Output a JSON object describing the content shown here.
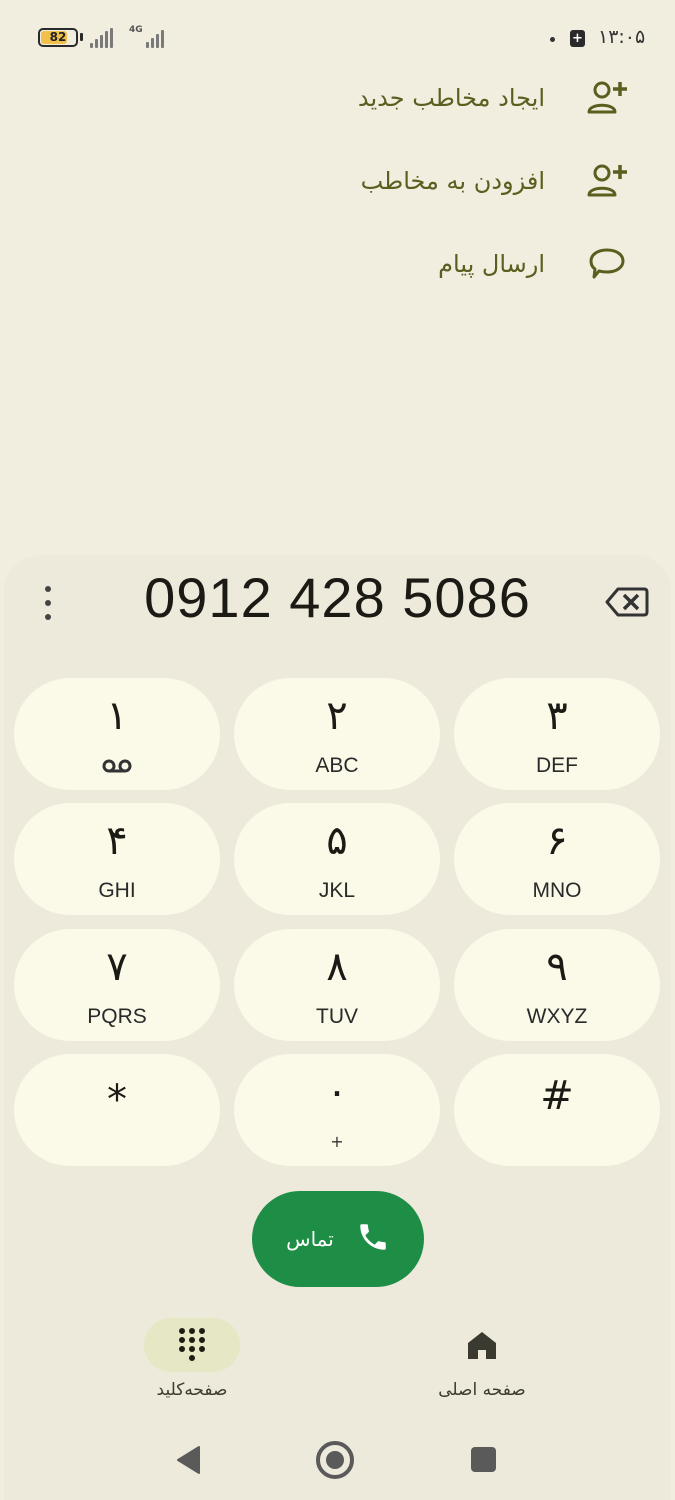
{
  "status_bar": {
    "battery_level": "82",
    "network_type": "4G",
    "time": "۱۳:۰۵",
    "notification_glyph": "+"
  },
  "actions": [
    {
      "label": "ایجاد مخاطب جدید",
      "icon": "person-add-icon"
    },
    {
      "label": "افزودن به مخاطب",
      "icon": "person-add-icon"
    },
    {
      "label": "ارسال پیام",
      "icon": "message-bubble-icon"
    }
  ],
  "dialer": {
    "number": "0912 428 5086",
    "keys": [
      {
        "digit": "۱",
        "sub": "voicemail-icon"
      },
      {
        "digit": "۲",
        "sub": "ABC"
      },
      {
        "digit": "۳",
        "sub": "DEF"
      },
      {
        "digit": "۴",
        "sub": "GHI"
      },
      {
        "digit": "۵",
        "sub": "JKL"
      },
      {
        "digit": "۶",
        "sub": "MNO"
      },
      {
        "digit": "۷",
        "sub": "PQRS"
      },
      {
        "digit": "۸",
        "sub": "TUV"
      },
      {
        "digit": "۹",
        "sub": "WXYZ"
      },
      {
        "digit": "*",
        "sub": ""
      },
      {
        "digit": "۰",
        "sub": "+"
      },
      {
        "digit": "#",
        "sub": ""
      }
    ],
    "call_label": "تماس"
  },
  "bottom_nav": {
    "keypad_label": "صفحه‌کلید",
    "home_label": "صفحه اصلی"
  },
  "colors": {
    "background": "#f1eedf",
    "key_background": "#fbf9e8",
    "accent_olive": "#5b5e1f",
    "call_green": "#1e8d46",
    "active_nav_pill": "#e6e7c4"
  }
}
